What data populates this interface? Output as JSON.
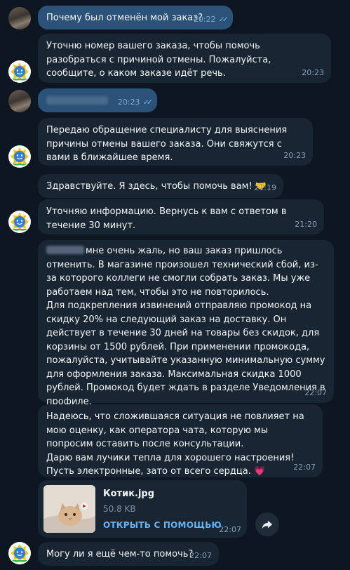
{
  "messages": [
    {
      "id": "m1",
      "direction": "out",
      "text": "Почему был отменён мой заказ?",
      "time": "20:22",
      "read": true
    },
    {
      "id": "m2",
      "direction": "in",
      "text": "Уточню номер вашего заказа, чтобы помочь разобраться с причиной отмены. Пожалуйста, сообщите, о каком заказе идёт речь.",
      "time": "20:23"
    },
    {
      "id": "m3",
      "direction": "out",
      "text": "",
      "time": "20:23",
      "read": true
    },
    {
      "id": "m4",
      "direction": "in",
      "text": "Передаю обращение специалисту для выяснения причины отмены вашего заказа. Они свяжутся с вами в ближайшее время.",
      "time": "20:23"
    },
    {
      "id": "m5",
      "direction": "in",
      "text": "Здравствуйте. Я здесь, чтобы помочь вам! 🤝",
      "time": "21:19"
    },
    {
      "id": "m6",
      "direction": "in",
      "text": "Уточняю информацию. Вернусь к вам с ответом в течение 30 минут.",
      "time": "21:20"
    },
    {
      "id": "m7",
      "direction": "in",
      "text": "мне очень жаль, но ваш заказ пришлось отменить. В магазине произошел технический сбой, из-за которого коллеги не смогли собрать заказ. Мы уже работаем над тем, чтобы это не повторилось.\nДля подкрепления извинений отправляю промокод на скидку 20% на следующий заказ на доставку. Он действует в течение 30 дней на товары без скидок, для корзины от 1500 рублей. При применении промокода, пожалуйста, учитывайте указанную минимальную сумму для оформления заказа. Максимальная скидка 1000 рублей. Промокод будет ждать в разделе Уведомления в профиле.\nПриносим извинения за эту ситуацию!",
      "time": "22:07"
    },
    {
      "id": "m8",
      "direction": "in",
      "text": "Надеюсь, что сложившаяся ситуация не повлияет на мою оценку, как оператора чата, которую мы попросим оставить после консультации.\nДарю вам лучики тепла для хорошего настроения!\nПусть электронные, зато от всего сердца. 💗",
      "time": "22:07"
    },
    {
      "id": "m10",
      "direction": "in",
      "text": "Могу ли я ещё чем-то помочь?",
      "time": "22:07"
    }
  ],
  "file_message": {
    "name": "Котик.jpg",
    "size": "50.8 KB",
    "action": "ОТКРЫТЬ С ПОМОЩЬЮ",
    "time": "22:07",
    "thumb_icon": "cat-photo"
  },
  "share_icon": "share-arrow-icon",
  "colors": {
    "background": "#0e1621",
    "outgoing": "#2b5278",
    "incoming": "#182533",
    "accent": "#6ab3f3"
  }
}
